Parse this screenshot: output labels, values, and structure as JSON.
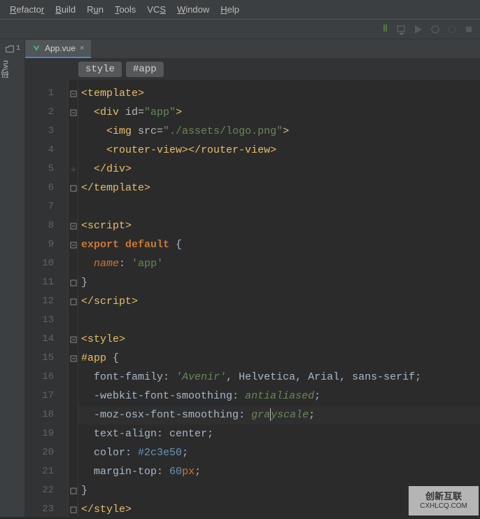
{
  "menu": {
    "refactor": "Refactor",
    "build": "Build",
    "run": "Run",
    "tools": "Tools",
    "vcs": "VCS",
    "window": "Window",
    "help": "Help"
  },
  "tab": {
    "filename": "App.vue"
  },
  "crumbs": {
    "c1": "style",
    "c2": "#app"
  },
  "left": {
    "vert": "码\\vu"
  },
  "lines": {
    "l1": "1",
    "l2": "2",
    "l3": "3",
    "l4": "4",
    "l5": "5",
    "l6": "6",
    "l7": "7",
    "l8": "8",
    "l9": "9",
    "l10": "10",
    "l11": "11",
    "l12": "12",
    "l13": "13",
    "l14": "14",
    "l15": "15",
    "l16": "16",
    "l17": "17",
    "l18": "18",
    "l19": "19",
    "l20": "20",
    "l21": "21",
    "l22": "22",
    "l23": "23"
  },
  "code": {
    "t_template_o": "<template>",
    "t_div_o1": "<div ",
    "t_div_attr": "id=",
    "t_div_val": "\"app\"",
    "t_div_o2": ">",
    "t_img": "<img ",
    "t_img_attr": "src=",
    "t_img_val": "\"./assets/logo.png\"",
    "t_img_c": ">",
    "t_rv_o": "<router-view>",
    "t_rv_c": "</router-view>",
    "t_div_c": "</div>",
    "t_template_c": "</template>",
    "s_script_o": "<script>",
    "s_export": "export default ",
    "s_brace_o": "{",
    "s_name": "name",
    "s_colon": ": ",
    "s_q1": "'",
    "s_app": "app",
    "s_q2": "'",
    "s_brace_c": "}",
    "s_script_c": "</script>",
    "st_style_o": "<style>",
    "st_sel": "#app",
    "st_brace_o": " {",
    "st_ff": "font-family",
    "st_ff_v1": "'Avenir'",
    "st_ff_v2": "Helvetica",
    "st_ff_v3": "Arial",
    "st_ff_v4": "sans-serif",
    "st_wfs": "-webkit-font-smoothing",
    "st_wfs_v": "antialiased",
    "st_mfs": "-moz-osx-font-smoothing",
    "st_mfs_v1": "gra",
    "st_mfs_v2": "yscale",
    "st_ta": "text-align",
    "st_ta_v": "center",
    "st_color": "color",
    "st_color_v": "#2c3e50",
    "st_mt": "margin-top",
    "st_mt_v": "60",
    "st_mt_u": "px",
    "st_brace_c": "}",
    "st_style_c": "</style>"
  },
  "watermark": {
    "big": "创新互联",
    "small": "CXHLCQ.COM"
  }
}
